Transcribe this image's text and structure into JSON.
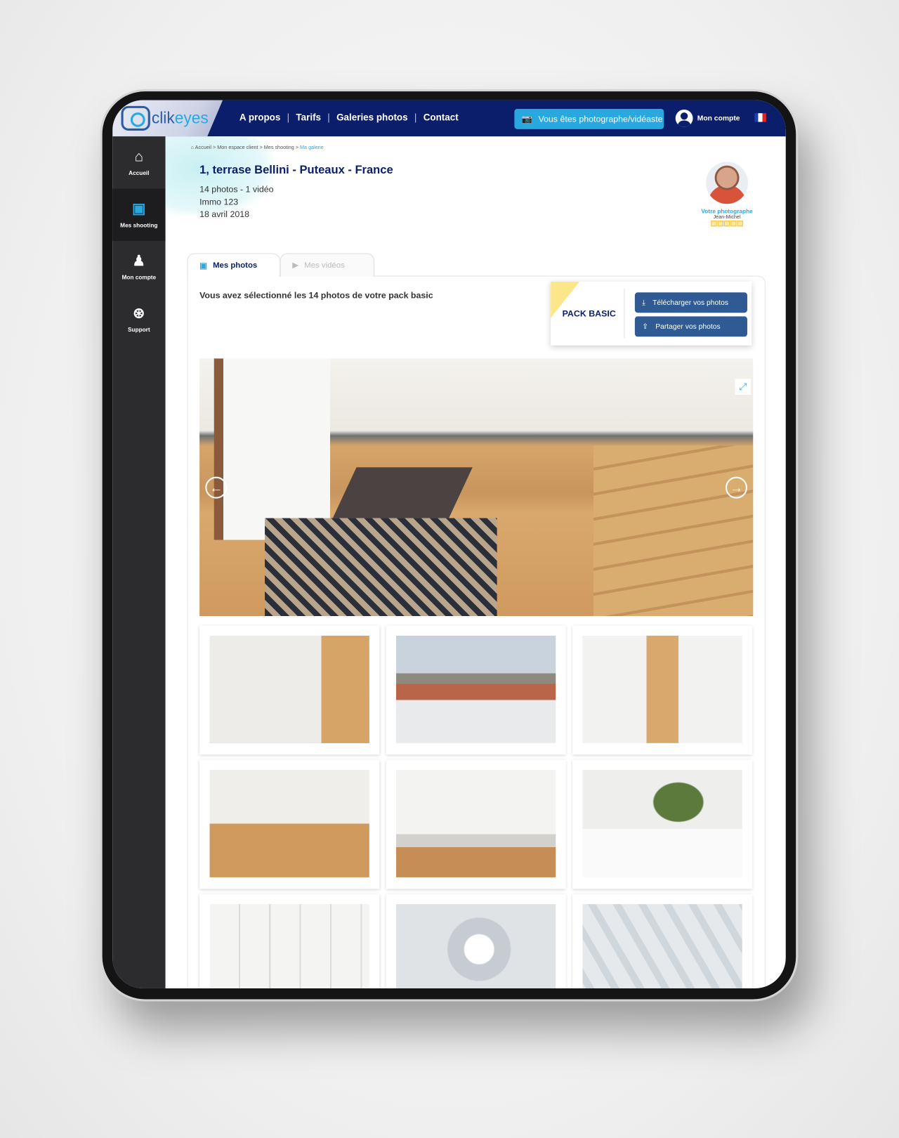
{
  "brand": {
    "name_a": "clik",
    "name_b": "eyes"
  },
  "nav": {
    "links": [
      "A propos",
      "Tarifs",
      "Galeries photos",
      "Contact"
    ],
    "pro_button": "Vous êtes photographe/vidéaste",
    "account": "Mon compte",
    "language": "FR"
  },
  "sidebar": {
    "items": [
      {
        "label": "Accueil",
        "icon": "home-icon"
      },
      {
        "label": "Mes shooting",
        "icon": "photos-icon",
        "active": true
      },
      {
        "label": "Mon compte",
        "icon": "user-icon"
      },
      {
        "label": "Support",
        "icon": "lifebuoy-icon"
      }
    ]
  },
  "breadcrumb": [
    "Accueil",
    "Mon espace client",
    "Mes shooting",
    "Ma galerie"
  ],
  "shooting": {
    "title": "1, terrase Bellini - Puteaux - France",
    "count": "14 photos - 1 vidéo",
    "ref": "Immo 123",
    "date": "18 avril 2018"
  },
  "photographer": {
    "label": "Votre photographe",
    "name": "Jean-Michel",
    "rating": 5
  },
  "tabs": [
    {
      "label": "Mes photos",
      "active": true
    },
    {
      "label": "Mes vidéos",
      "active": false
    }
  ],
  "selection_text": "Vous avez sélectionné les 14 photos de votre pack basic",
  "pack": {
    "name": "PACK BASIC",
    "download": "Télécharger vos photos",
    "share": "Partager vos photos"
  },
  "colors": {
    "navy": "#0b1e6b",
    "accent": "#29a8e0",
    "button": "#2f5a94",
    "sidebar": "#2c2c2f"
  }
}
